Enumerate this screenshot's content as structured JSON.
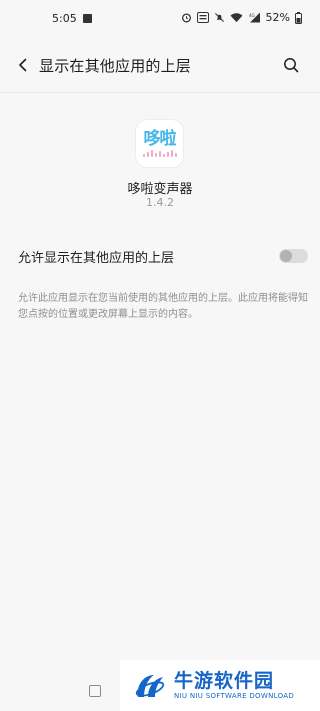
{
  "status_bar": {
    "time": "5:05",
    "battery_percent": "52%"
  },
  "app_bar": {
    "title": "显示在其他应用的上层",
    "back_icon": "back-arrow-icon",
    "search_icon": "search-icon"
  },
  "app_info": {
    "name": "哆啦变声器",
    "version": "1.4.2",
    "icon_text": "哆啦"
  },
  "setting": {
    "label": "允许显示在其他应用的上层",
    "enabled": false,
    "description": "允许此应用显示在您当前使用的其他应用的上层。此应用将能得知您点按的位置或更改屏幕上显示的内容。"
  },
  "watermark": {
    "title": "牛游软件园",
    "subtitle": "NIU NIU SOFTWARE DOWNLOAD"
  },
  "colors": {
    "background": "#f7f7f7",
    "toggle_off": "#dcdcdc",
    "watermark_blue": "#1566c8"
  }
}
